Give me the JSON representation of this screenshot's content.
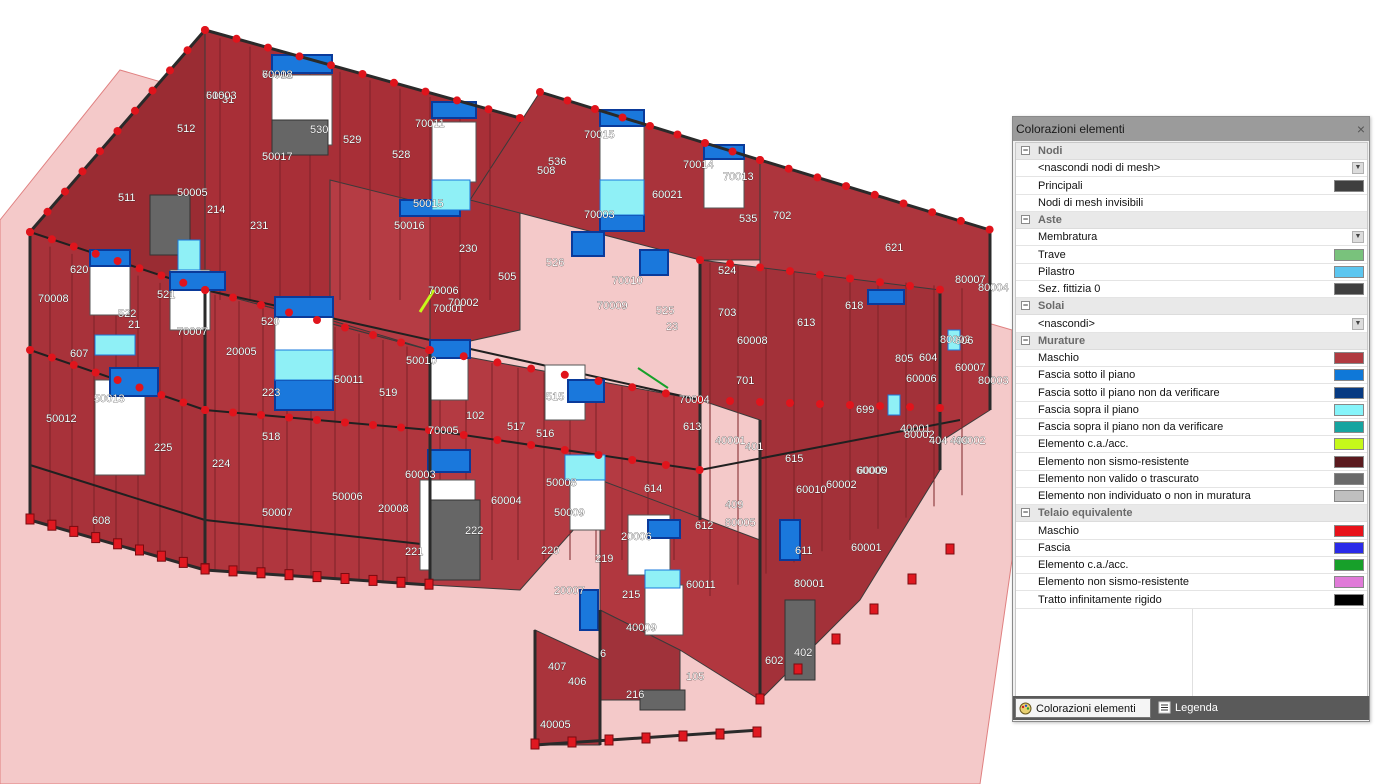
{
  "viewport": {
    "element_labels": [
      "70012",
      "515",
      "31",
      "512",
      "530",
      "529",
      "528",
      "70011",
      "70015",
      "536",
      "508",
      "70014",
      "70013",
      "50017",
      "511",
      "50005",
      "214",
      "231",
      "50015",
      "50016",
      "230",
      "70003",
      "60021",
      "535",
      "702",
      "621",
      "620",
      "70008",
      "522",
      "21",
      "521",
      "70007",
      "20005",
      "520",
      "70006",
      "70001",
      "70002",
      "505",
      "526",
      "70010",
      "70009",
      "525",
      "23",
      "524",
      "703",
      "613",
      "618",
      "80007",
      "80004",
      "607",
      "50013",
      "50012",
      "225",
      "224",
      "223",
      "50011",
      "519",
      "518",
      "50010",
      "70005",
      "102",
      "517",
      "516",
      "515",
      "70004",
      "60008",
      "701",
      "699",
      "80002",
      "606",
      "60007",
      "60006",
      "604",
      "805",
      "80003",
      "404",
      "403",
      "40002",
      "40001",
      "80002",
      "60005",
      "60004",
      "60003",
      "50008",
      "50009",
      "50007",
      "50006",
      "20008",
      "222",
      "221",
      "220",
      "20007",
      "219",
      "20006",
      "612",
      "80005",
      "409",
      "60011",
      "60010",
      "611",
      "80001",
      "60002",
      "60001",
      "602",
      "402",
      "401",
      "40001",
      "615",
      "614",
      "613",
      "608",
      "6",
      "105",
      "407",
      "406",
      "40005",
      "216",
      "215",
      "40009",
      "60009",
      "60008",
      "60003"
    ]
  },
  "panel": {
    "title": "Colorazioni elementi",
    "close_label": "×",
    "groups": [
      {
        "label": "Nodi",
        "toggle": "⊟",
        "rows": [
          {
            "type": "dropdown",
            "label": "<nascondi nodi di mesh>"
          },
          {
            "type": "color",
            "label": "Principali",
            "color": "#3f3f3f"
          },
          {
            "type": "text",
            "label": "Nodi di mesh invisibili"
          }
        ]
      },
      {
        "label": "Aste",
        "toggle": "⊟",
        "rows": [
          {
            "type": "dropdown",
            "label": "Membratura"
          },
          {
            "type": "color",
            "label": "Trave",
            "color": "#79c27c"
          },
          {
            "type": "color",
            "label": "Pilastro",
            "color": "#5cc6f0"
          },
          {
            "type": "color",
            "label": "Sez. fittizia 0",
            "color": "#3f3f3f"
          }
        ]
      },
      {
        "label": "Solai",
        "toggle": "⊟",
        "rows": [
          {
            "type": "dropdown",
            "label": "<nascondi>"
          }
        ]
      },
      {
        "label": "Murature",
        "toggle": "⊟",
        "rows": [
          {
            "type": "color",
            "label": "Maschio",
            "color": "#b03a40"
          },
          {
            "type": "color",
            "label": "Fascia sotto il piano",
            "color": "#0f78d8"
          },
          {
            "type": "color",
            "label": "Fascia sotto il piano non da verificare",
            "color": "#073a82"
          },
          {
            "type": "color",
            "label": "Fascia sopra il piano",
            "color": "#86f4fa"
          },
          {
            "type": "color",
            "label": "Fascia sopra il piano non da verificare",
            "color": "#16a4a0"
          },
          {
            "type": "color",
            "label": "Elemento c.a./acc.",
            "color": "#c6f81a"
          },
          {
            "type": "color",
            "label": "Elemento non sismo-resistente",
            "color": "#5a1a1e"
          },
          {
            "type": "color",
            "label": "Elemento non valido o trascurato",
            "color": "#6a6a6a"
          },
          {
            "type": "color",
            "label": "Elemento non individuato o non in muratura",
            "color": "#bfbfbf"
          }
        ]
      },
      {
        "label": "Telaio equivalente",
        "toggle": "⊟",
        "rows": [
          {
            "type": "color",
            "label": "Maschio",
            "color": "#e8121a"
          },
          {
            "type": "color",
            "label": "Fascia",
            "color": "#2a2ae8"
          },
          {
            "type": "color",
            "label": "Elemento c.a./acc.",
            "color": "#17a02a"
          },
          {
            "type": "color",
            "label": "Elemento non sismo-resistente",
            "color": "#e07ad8"
          },
          {
            "type": "color",
            "label": "Tratto infinitamente rigido",
            "color": "#000000"
          }
        ]
      }
    ],
    "tabs": [
      {
        "label": "Colorazioni elementi",
        "active": true,
        "icon": "palette-icon"
      },
      {
        "label": "Legenda",
        "active": false,
        "icon": "list-icon"
      }
    ]
  }
}
